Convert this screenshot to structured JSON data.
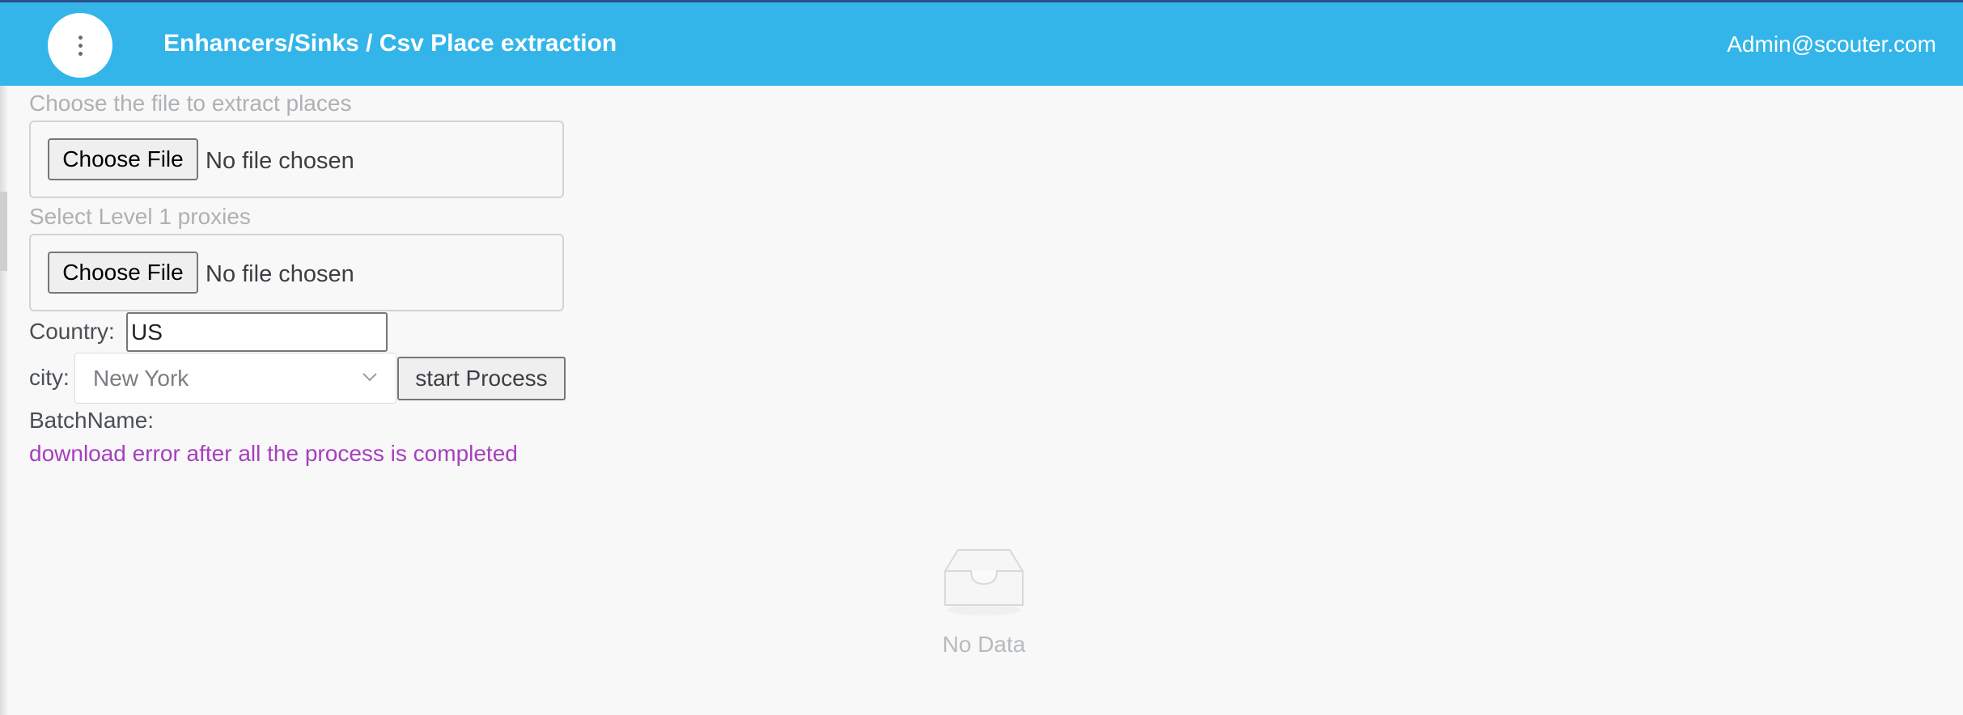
{
  "header": {
    "title": "Enhancers/Sinks / Csv Place extraction",
    "user": "Admin@scouter.com",
    "background_color": "#33b5ea",
    "menu_icon": "more-vertical-icon"
  },
  "form": {
    "places_file": {
      "label": "Choose the file to extract places",
      "button_label": "Choose File",
      "status": "No file chosen"
    },
    "proxies_file": {
      "label": "Select Level 1 proxies",
      "button_label": "Choose File",
      "status": "No file chosen"
    },
    "country": {
      "label": "Country:",
      "value": "US"
    },
    "city": {
      "label": "city:",
      "selected": "New York",
      "icon": "chevron-down-icon"
    },
    "start_button_label": "start Process",
    "batch_name_label": "BatchName:",
    "download_error_link": "download error after all the process is completed",
    "link_color": "#a63fbd"
  },
  "empty_state": {
    "icon": "inbox-icon",
    "text": "No Data"
  }
}
